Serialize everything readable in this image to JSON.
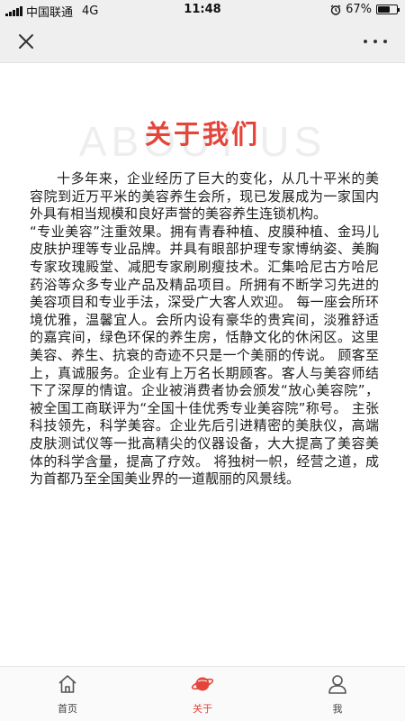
{
  "status_bar": {
    "carrier": "中国联通",
    "network": "4G",
    "time": "11:48",
    "battery_percent": "67%",
    "battery_level": 0.67
  },
  "nav": {
    "close_icon": "close-icon",
    "more_icon": "more-dots-icon"
  },
  "page": {
    "title": "关于我们",
    "title_bg": "ABOUT US",
    "paragraphs": [
      "十多年来，企业经历了巨大的变化，从几十平米的美容院到近万平米的美容养生会所，现已发展成为一家国内外具有相当规模和良好声誉的美容养生连锁机构。",
      "“专业美容”注重效果。拥有青春种植、皮膜种植、金玛儿皮肤护理等专业品牌。并具有眼部护理专家博纳姿、美胸专家玫瑰殿堂、减肥专家刷刷瘦技术。汇集哈尼古方哈尼药浴等众多专业产品及精品项目。所拥有不断学习先进的美容项目和专业手法，深受广大客人欢迎。 每一座会所环境优雅，温馨宜人。会所内设有豪华的贵宾间，淡雅舒适的嘉宾间，绿色环保的养生房，恬静文化的休闲区。这里美容、养生、抗衰的奇迹不只是一个美丽的传说。 顾客至上，真诚服务。企业有上万名长期顾客。客人与美容师结下了深厚的情谊。企业被消费者协会颁发“放心美容院”，被全国工商联评为“全国十佳优秀专业美容院”称号。 主张科技领先，科学美容。企业先后引进精密的美肤仪，高端皮肤测试仪等一批高精尖的仪器设备，大大提高了美容美体的科学含量，提高了疗效。 将独树一帜，经营之道，成为首都乃至全国美业界的一道靓丽的风景线。"
    ]
  },
  "tab_bar": {
    "tabs": [
      {
        "label": "首页",
        "icon": "home-icon",
        "active": false
      },
      {
        "label": "关于",
        "icon": "planet-icon",
        "active": true
      },
      {
        "label": "我",
        "icon": "user-icon",
        "active": false
      }
    ]
  },
  "colors": {
    "accent": "#e5443a",
    "bar_bg": "#efefef",
    "title_bg_text": "#eeeeee"
  }
}
